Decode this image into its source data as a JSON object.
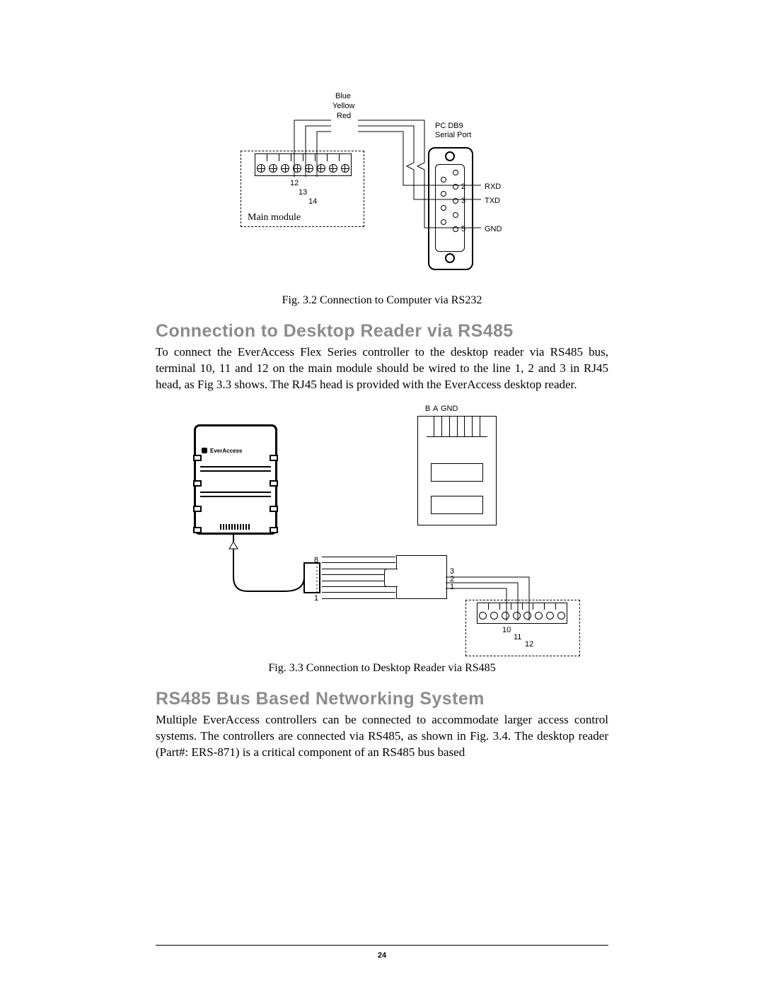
{
  "figure32": {
    "wire_labels": {
      "blue": "Blue",
      "yellow": "Yellow",
      "red": "Red"
    },
    "port_label1": "PC DB9",
    "port_label2": "Serial Port",
    "pin_numbers_terminal": {
      "p12": "12",
      "p13": "13",
      "p14": "14"
    },
    "module_label": "Main module",
    "db9_pins": {
      "p2": "2",
      "p3": "3",
      "p5": "5"
    },
    "db9_signals": {
      "rxd": "RXD",
      "txd": "TXD",
      "gnd": "GND"
    },
    "caption": "Fig. 3.2 Connection to Computer via RS232"
  },
  "section1": {
    "heading": "Connection to Desktop Reader via RS485",
    "body": "To connect the EverAccess Flex Series controller to the desktop reader via RS485 bus, terminal 10, 11 and 12 on the main module should be wired to the line 1, 2 and 3 in RJ45 head, as Fig 3.3 shows. The RJ45 head is provided with the EverAccess desktop reader."
  },
  "figure33": {
    "jack_labels": {
      "b": "B",
      "a": "A",
      "gnd": "GND"
    },
    "reader_brand": "EverAccess",
    "plug_pins": {
      "p8": "8",
      "p1": "1"
    },
    "out_pins": {
      "p3": "3",
      "p2": "2",
      "p1": "1"
    },
    "term_pins": {
      "p10": "10",
      "p11": "11",
      "p12": "12"
    },
    "caption": "Fig. 3.3 Connection to Desktop Reader via RS485"
  },
  "section2": {
    "heading": "RS485 Bus Based Networking System",
    "body": "Multiple EverAccess controllers can be connected to accommodate larger access control systems.  The controllers are connected via RS485, as shown in Fig. 3.4.  The desktop reader (Part#: ERS-871) is a critical component of an RS485 bus based"
  },
  "page_number": "24"
}
